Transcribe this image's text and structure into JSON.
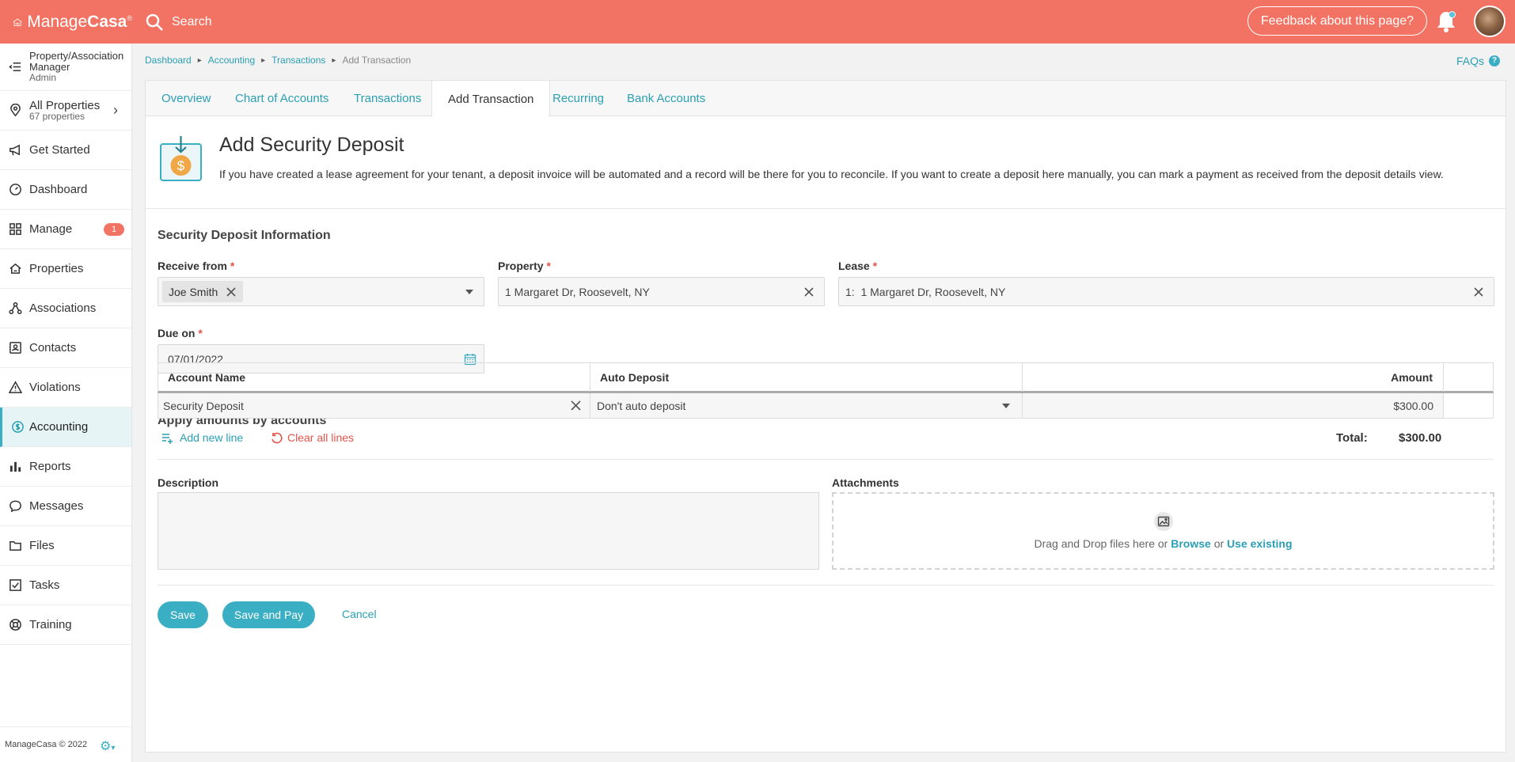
{
  "brand": {
    "name_light": "Manage",
    "name_bold": "Casa",
    "accent": "#f27263",
    "teal": "#3aaec2"
  },
  "topbar": {
    "search_label": "Search",
    "feedback_label": "Feedback about this page?"
  },
  "sidebar": {
    "role": {
      "title": "Property/Association Manager",
      "sub": "Admin"
    },
    "properties": {
      "title": "All Properties",
      "sub": "67 properties"
    },
    "items": [
      {
        "label": "Get Started",
        "icon": "megaphone-icon"
      },
      {
        "label": "Dashboard",
        "icon": "gauge-icon"
      },
      {
        "label": "Manage",
        "icon": "grid-icon",
        "badge": "1"
      },
      {
        "label": "Properties",
        "icon": "house-icon"
      },
      {
        "label": "Associations",
        "icon": "network-icon"
      },
      {
        "label": "Contacts",
        "icon": "contact-card-icon"
      },
      {
        "label": "Violations",
        "icon": "warning-icon"
      },
      {
        "label": "Accounting",
        "icon": "dollar-icon"
      },
      {
        "label": "Reports",
        "icon": "bar-chart-icon"
      },
      {
        "label": "Messages",
        "icon": "chat-icon"
      },
      {
        "label": "Files",
        "icon": "folder-icon"
      },
      {
        "label": "Tasks",
        "icon": "checkbox-icon"
      },
      {
        "label": "Training",
        "icon": "lifebuoy-icon"
      }
    ],
    "footer": "ManageCasa © 2022"
  },
  "breadcrumb": {
    "items": [
      "Dashboard",
      "Accounting",
      "Transactions"
    ],
    "current": "Add Transaction"
  },
  "faqs_label": "FAQs",
  "tabs": [
    "Overview",
    "Chart of Accounts",
    "Transactions",
    "Add Transaction",
    "Recurring",
    "Bank Accounts"
  ],
  "header": {
    "title": "Add Security Deposit",
    "description": "If you have created a lease agreement for your tenant, a deposit invoice will be automated and a record will be there for you to reconcile. If you want to create a deposit here manually, you can mark a payment as received from the deposit details view."
  },
  "form": {
    "section_title": "Security Deposit Information",
    "receive_from": {
      "label": "Receive from",
      "value": "Joe Smith"
    },
    "property": {
      "label": "Property",
      "value": "1 Margaret Dr, Roosevelt, NY"
    },
    "lease": {
      "label": "Lease",
      "value": "1:  1 Margaret Dr, Roosevelt, NY"
    },
    "due_on": {
      "label": "Due on",
      "value": "07/01/2022"
    },
    "required_mark": "*"
  },
  "accounts": {
    "section_title": "Apply amounts by accounts",
    "columns": [
      "Account Name",
      "Auto Deposit",
      "Amount"
    ],
    "rows": [
      {
        "account": "Security Deposit",
        "auto_deposit": "Don't auto deposit",
        "amount": "$300.00"
      }
    ],
    "add_line": "Add new line",
    "clear_lines": "Clear all lines",
    "total_label": "Total:",
    "total_value": "$300.00"
  },
  "description": {
    "label": "Description"
  },
  "attachments": {
    "label": "Attachments",
    "text": "Drag and Drop files here or",
    "browse": "Browse",
    "or": "or",
    "use_existing": "Use existing"
  },
  "actions": {
    "save": "Save",
    "save_pay": "Save and Pay",
    "cancel": "Cancel"
  }
}
